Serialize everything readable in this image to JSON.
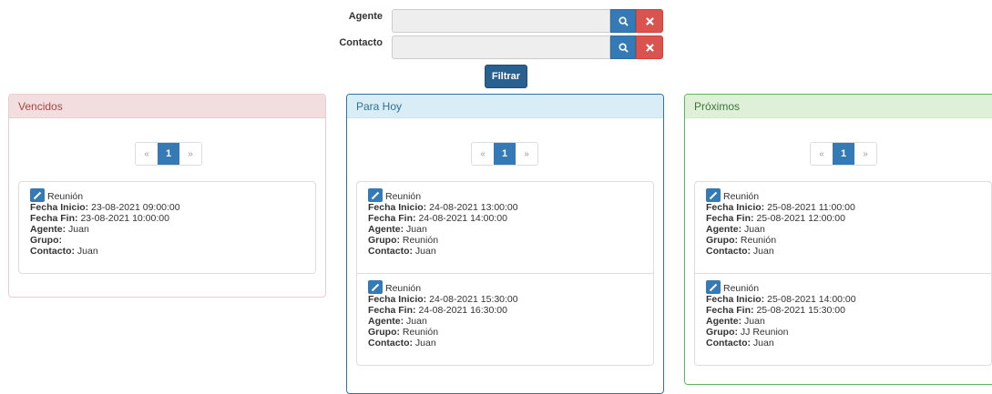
{
  "filters": {
    "agente": {
      "label": "Agente",
      "value": ""
    },
    "contacto": {
      "label": "Contacto",
      "value": ""
    },
    "filter_button": "Filtrar"
  },
  "labels": {
    "fecha_inicio": "Fecha Inicio:",
    "fecha_fin": "Fecha Fin:",
    "agente": "Agente:",
    "grupo": "Grupo:",
    "contacto": "Contacto:"
  },
  "pagination": {
    "prev": "«",
    "current": "1",
    "next": "»"
  },
  "colors": {
    "primary": "#337ab7",
    "danger": "#d9534f",
    "vencidos_bg": "#f2dede",
    "hoy_bg": "#d9edf7",
    "proximos_bg": "#dff0d8"
  },
  "panels": [
    {
      "title": "Vencidos",
      "events": [
        {
          "name": "Reunión",
          "fecha_inicio": "23-08-2021 09:00:00",
          "fecha_fin": "23-08-2021 10:00:00",
          "agente": "Juan",
          "grupo": "",
          "contacto": "Juan"
        }
      ]
    },
    {
      "title": "Para Hoy",
      "events": [
        {
          "name": "Reunión",
          "fecha_inicio": "24-08-2021 13:00:00",
          "fecha_fin": "24-08-2021 14:00:00",
          "agente": "Juan",
          "grupo": "Reunión",
          "contacto": "Juan"
        },
        {
          "name": "Reunión",
          "fecha_inicio": "24-08-2021 15:30:00",
          "fecha_fin": "24-08-2021 16:30:00",
          "agente": "Juan",
          "grupo": "Reunión",
          "contacto": "Juan"
        }
      ]
    },
    {
      "title": "Próximos",
      "events": [
        {
          "name": "Reunión",
          "fecha_inicio": "25-08-2021 11:00:00",
          "fecha_fin": "25-08-2021 12:00:00",
          "agente": "Juan",
          "grupo": "Reunión",
          "contacto": "Juan"
        },
        {
          "name": "Reunión",
          "fecha_inicio": "25-08-2021 14:00:00",
          "fecha_fin": "25-08-2021 15:30:00",
          "agente": "Juan",
          "grupo": "JJ Reunion",
          "contacto": "Juan"
        }
      ]
    }
  ]
}
